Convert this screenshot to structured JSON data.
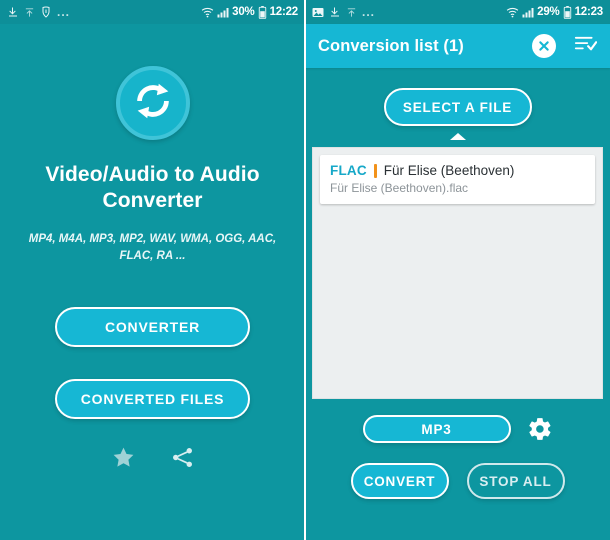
{
  "left": {
    "statusbar": {
      "icons": [
        "download-arrow-icon",
        "upload-arrow-icon",
        "shield-icon",
        "overflow-dots-icon"
      ],
      "dots": "...",
      "battery_percent": "30%",
      "time": "12:22",
      "right_icons": [
        "wifi-icon",
        "signal-icon",
        "battery-icon"
      ]
    },
    "logo_icon": "convert-refresh-icon",
    "app_title": "Video/Audio to Audio Converter",
    "formats": "MP4, M4A, MP3, MP2, WAV, WMA, OGG, AAC, FLAC, RA ...",
    "buttons": {
      "converter": "CONVERTER",
      "converted_files": "CONVERTED FILES"
    },
    "bottom_icons": [
      "star-icon",
      "share-icon"
    ]
  },
  "right": {
    "statusbar": {
      "icons": [
        "image-icon",
        "download-arrow-icon",
        "upload-arrow-icon",
        "overflow-dots-icon"
      ],
      "dots": "...",
      "battery_percent": "29%",
      "time": "12:23",
      "right_icons": [
        "wifi-icon",
        "signal-icon",
        "battery-icon"
      ]
    },
    "appbar": {
      "title": "Conversion list (1)",
      "close_icon": "close-icon",
      "select_all_icon": "list-check-icon"
    },
    "select_file_button": "SELECT A FILE",
    "caret_icon": "caret-up-icon",
    "files": [
      {
        "extension": "FLAC",
        "title": "Für Elise (Beethoven)",
        "filename": "Für Elise (Beethoven).flac"
      }
    ],
    "format_button": "MP3",
    "settings_icon": "gear-icon",
    "actions": {
      "convert": "CONVERT",
      "stop_all": "STOP ALL"
    }
  },
  "colors": {
    "background_teal": "#0d96a0",
    "accent_cyan": "#16b7d4",
    "appbar_cyan": "#16b7d4",
    "separator_orange": "#f2921b",
    "ext_label_cyan": "#16a8c8",
    "list_bg_gray": "#eceff0"
  }
}
